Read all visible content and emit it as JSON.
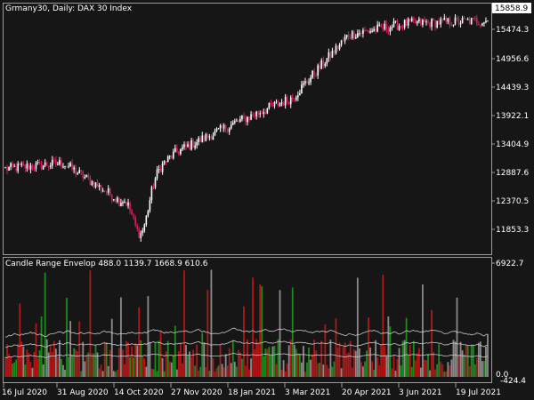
{
  "main_chart": {
    "title": "Grmany30, Daily:  DAX 30 Index",
    "current_price": "15858.9",
    "price_labels": [
      "15474.3",
      "14956.6",
      "14439.3",
      "13922.1",
      "13404.9",
      "12887.6",
      "12370.5",
      "11853.3"
    ]
  },
  "indicator": {
    "title": "Candle Range Envelop 488.0 1139.7 1668.9 610.6",
    "values": [
      "488.0",
      "1139.7",
      "1668.9",
      "610.6"
    ],
    "scale_labels": [
      "6922.7",
      "0.0",
      "-424.4"
    ]
  },
  "time_axis": {
    "labels": [
      "16 Jul 2020",
      "31 Aug 2020",
      "14 Oct 2020",
      "27 Nov 2020",
      "18 Jan 2021",
      "3 Mar 2021",
      "20 Apr 2021",
      "3 Jun 2021",
      "19 Jul 2021"
    ]
  },
  "colors": {
    "background": "#161616",
    "frame": "#9b9b9b",
    "bull_candle": "#ffffff",
    "bear_candle": "#d1205a",
    "hist_green": "#1e8a1e",
    "hist_red": "#b01818",
    "hist_gray": "#8a8a8a",
    "envelope": "#c8c8c8"
  },
  "chart_data": {
    "type": "line",
    "title": "Grmany30, Daily:  DAX 30 Index",
    "x": [
      "16 Jul 2020",
      "31 Aug 2020",
      "14 Oct 2020",
      "27 Nov 2020",
      "18 Jan 2021",
      "3 Mar 2021",
      "20 Apr 2021",
      "3 Jun 2021",
      "19 Jul 2021"
    ],
    "series": [
      {
        "name": "",
        "values": [
          13100,
          13200,
          12550,
          13400,
          13900,
          14350,
          15450,
          15650,
          15700
        ]
      }
    ],
    "ylim": [
      11600,
      16000
    ],
    "grid": false,
    "xlabel": "",
    "ylabel": ""
  }
}
